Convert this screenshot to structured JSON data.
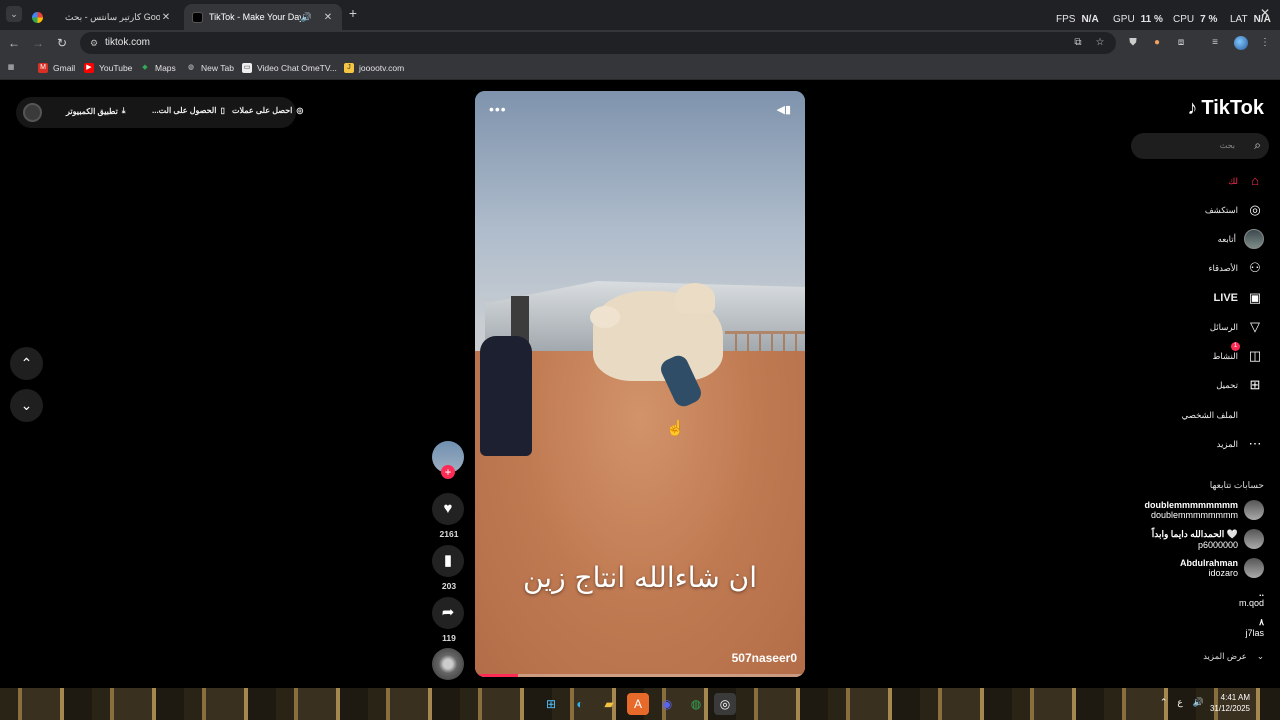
{
  "browser": {
    "tabs": [
      {
        "title": "كارتير سانتس - بحث Google",
        "favicon": "google-icon",
        "active": false
      },
      {
        "title": "TikTok - Make Your Day",
        "favicon": "tiktok-icon",
        "active": true,
        "audio": true
      }
    ],
    "url": "tiktok.com",
    "perf": {
      "fps_label": "FPS",
      "fps_value": "N/A",
      "gpu_label": "GPU",
      "gpu_value": "11 %",
      "cpu_label": "CPU",
      "cpu_value": "7 %",
      "lat_label": "LAT",
      "lat_value": "N/A"
    },
    "bookmarks": [
      "Gmail",
      "YouTube",
      "Maps",
      "New Tab",
      "Video Chat OmeTV...",
      "jooootv.com"
    ]
  },
  "topbar": {
    "coins": "احصل على عملات",
    "get_app": "الحصول على الت...",
    "desktop_app": "تطبيق الكمبيوتر"
  },
  "video": {
    "caption": "ان شاءالله انتاج زين",
    "username": "507naseer0",
    "progress": 0.13
  },
  "actions": {
    "likes": "2161",
    "saves": "203",
    "shares": "119"
  },
  "sidebar": {
    "logo": "TikTok",
    "search_placeholder": "بحث",
    "nav": [
      {
        "label": "لك",
        "icon": "home-icon",
        "active": true
      },
      {
        "label": "استكشف",
        "icon": "compass-icon"
      },
      {
        "label": "أتابعه",
        "icon": "avatar-icon"
      },
      {
        "label": "الأصدقاء",
        "icon": "friends-icon"
      },
      {
        "label": "LIVE",
        "icon": "live-icon"
      },
      {
        "label": "الرسائل",
        "icon": "send-icon"
      },
      {
        "label": "النشاط",
        "icon": "inbox-icon",
        "badge": "1"
      },
      {
        "label": "تحميل",
        "icon": "upload-icon"
      },
      {
        "label": "الملف الشخصي",
        "icon": "profile-icon"
      },
      {
        "label": "المزيد",
        "icon": "more-icon"
      }
    ],
    "following_title": "حسابات تتابعها",
    "accounts": [
      {
        "name": "doublemmmmmmmm",
        "username": "doublemmmmmmmm"
      },
      {
        "name": "الحمدالله دايما وابداً 🤍",
        "username": "p6000000"
      },
      {
        "name": "Abdulrahman",
        "username": "idozaro"
      },
      {
        "name": "..",
        "username": "m.qod"
      },
      {
        "name": "٨",
        "username": "j7las"
      }
    ],
    "see_more": "عرض المزيد"
  },
  "taskbar": {
    "time": "4:41 AM",
    "date": "31/12/2025",
    "lang": "ع"
  }
}
